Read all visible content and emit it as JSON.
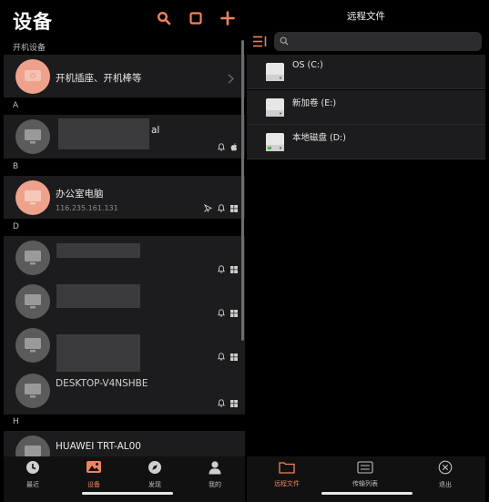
{
  "left": {
    "title": "设备",
    "powered_label": "开机设备",
    "powered_item": "开机插座、开机棒等",
    "sections": {
      "a": "A",
      "b": "B",
      "d": "D",
      "h": "H"
    },
    "devices": [
      {
        "name_suffix": "al"
      },
      {
        "name": "办公室电脑",
        "ip": "116.235.161.131"
      },
      {
        "name": ""
      },
      {
        "name": ""
      },
      {
        "name": ""
      },
      {
        "name": "DESKTOP-V4NSHBE"
      },
      {
        "name": "HUAWEI TRT-AL00"
      }
    ],
    "tabs": [
      {
        "label": "最近",
        "icon": "clock-icon"
      },
      {
        "label": "设备",
        "icon": "gallery-icon"
      },
      {
        "label": "发现",
        "icon": "compass-icon"
      },
      {
        "label": "我的",
        "icon": "person-icon"
      }
    ],
    "active_tab": "设备"
  },
  "right": {
    "title": "远程文件",
    "search_placeholder": "",
    "drives": [
      {
        "name": "OS (C:)",
        "icon": "drive-icon"
      },
      {
        "name": "新加卷 (E:)",
        "icon": "drive-icon"
      },
      {
        "name": "本地磁盘 (D:)",
        "icon": "drive-icon"
      }
    ],
    "tabs": [
      {
        "label": "远程文件",
        "icon": "folder-icon"
      },
      {
        "label": "传输列表",
        "icon": "list-icon"
      },
      {
        "label": "退出",
        "icon": "close-circle-icon"
      }
    ],
    "active_tab": "远程文件"
  },
  "colors": {
    "accent": "#f0835d",
    "row_bg": "#1c1c1e",
    "bg": "#000000"
  }
}
